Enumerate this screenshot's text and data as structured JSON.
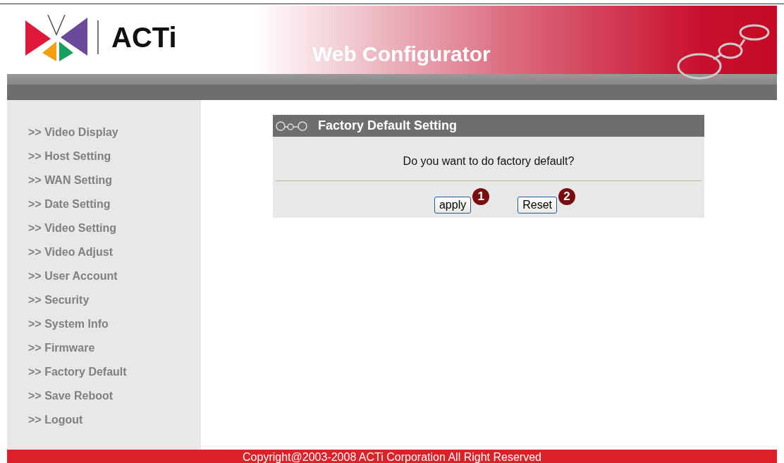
{
  "header": {
    "logo_text": "ACTi",
    "title": "Web Configurator"
  },
  "sidebar": {
    "items": [
      {
        "label": ">> Video Display"
      },
      {
        "label": ">> Host Setting"
      },
      {
        "label": ">> WAN Setting"
      },
      {
        "label": ">> Date Setting"
      },
      {
        "label": ">> Video Setting"
      },
      {
        "label": ">> Video Adjust"
      },
      {
        "label": ">> User Account"
      },
      {
        "label": ">> Security"
      },
      {
        "label": ">> System Info"
      },
      {
        "label": ">> Firmware"
      },
      {
        "label": ">> Factory Default"
      },
      {
        "label": ">> Save Reboot"
      },
      {
        "label": ">> Logout"
      }
    ]
  },
  "panel": {
    "title": "Factory Default Setting",
    "question": "Do you want to do factory default?",
    "buttons": [
      {
        "label": "apply",
        "badge": "1"
      },
      {
        "label": "Reset",
        "badge": "2"
      }
    ]
  },
  "footer": {
    "text": "Copyright@2003-2008 ACTi Corporation All Right Reserved"
  }
}
